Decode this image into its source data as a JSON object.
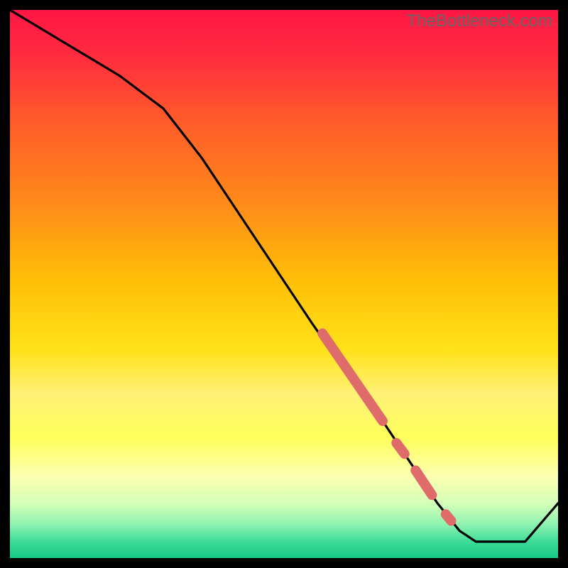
{
  "watermark": "TheBottleneck.com",
  "chart_data": {
    "type": "line",
    "title": "",
    "xlabel": "",
    "ylabel": "",
    "xlim": [
      0,
      100
    ],
    "ylim": [
      0,
      100
    ],
    "grid": false,
    "gradient_stops": [
      {
        "offset": 0.0,
        "color": "#ff1744"
      },
      {
        "offset": 0.08,
        "color": "#ff2a3f"
      },
      {
        "offset": 0.2,
        "color": "#ff5a2a"
      },
      {
        "offset": 0.35,
        "color": "#ff8a1a"
      },
      {
        "offset": 0.5,
        "color": "#ffc107"
      },
      {
        "offset": 0.62,
        "color": "#ffe21a"
      },
      {
        "offset": 0.7,
        "color": "#fff176"
      },
      {
        "offset": 0.78,
        "color": "#ffff5a"
      },
      {
        "offset": 0.85,
        "color": "#fcffb0"
      },
      {
        "offset": 0.9,
        "color": "#d4ffb8"
      },
      {
        "offset": 0.94,
        "color": "#8cf2b0"
      },
      {
        "offset": 0.97,
        "color": "#3ddc97"
      },
      {
        "offset": 1.0,
        "color": "#16c784"
      }
    ],
    "series": [
      {
        "name": "curve",
        "x": [
          0,
          10,
          20,
          28,
          35,
          45,
          55,
          62,
          68,
          74,
          78,
          82,
          85,
          90,
          94,
          100
        ],
        "y": [
          100,
          94,
          88,
          82,
          73,
          58,
          43,
          33,
          25,
          16,
          10,
          5,
          3,
          3,
          3,
          10
        ]
      }
    ],
    "highlight_segments": [
      {
        "x0": 57,
        "y0": 41,
        "x1": 68,
        "y1": 25
      },
      {
        "x0": 70.5,
        "y0": 21,
        "x1": 72,
        "y1": 19
      },
      {
        "x0": 74,
        "y0": 16,
        "x1": 77,
        "y1": 11.5
      },
      {
        "x0": 79.5,
        "y0": 8,
        "x1": 80.5,
        "y1": 6.8
      }
    ]
  }
}
